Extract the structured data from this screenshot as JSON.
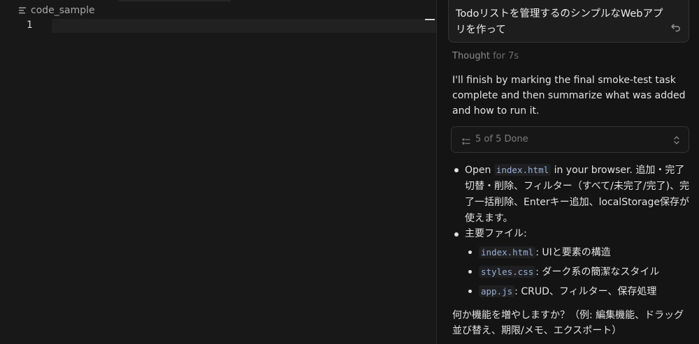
{
  "editor": {
    "file_name": "code_sample",
    "line_number": "1"
  },
  "chat": {
    "user_message": "Todoリストを管理するのシンプルなWebアプリを作って",
    "thought_label": "Thought",
    "thought_duration": "for 7s",
    "assistant_intro": "I'll finish by marking the final smoke-test task complete and then summarize what was added and how to run it.",
    "todo_status": "5 of 5 Done",
    "bullets": {
      "open_prefix": "Open",
      "open_code": "index.html",
      "open_text": "in your browser. 追加・完了切替・削除、フィルター（すべて/未完了/完了)、完了一括削除、Enterキー追加、localStorage保存が使えます。",
      "files_label": "主要ファイル:",
      "files": [
        {
          "code": "index.html",
          "desc": ": UIと要素の構造"
        },
        {
          "code": "styles.css",
          "desc": ": ダーク系の簡潔なスタイル"
        },
        {
          "code": "app.js",
          "desc": ": CRUD、フィルター、保存処理"
        }
      ]
    },
    "closing": "何か機能を増やしますか？（例: 編集機能、ドラッグ並び替え、期限/メモ、エクスポート）"
  },
  "colors": {
    "editor_bg": "#181818",
    "panel_bg": "#141414",
    "code_text": "#9ab0d6"
  }
}
